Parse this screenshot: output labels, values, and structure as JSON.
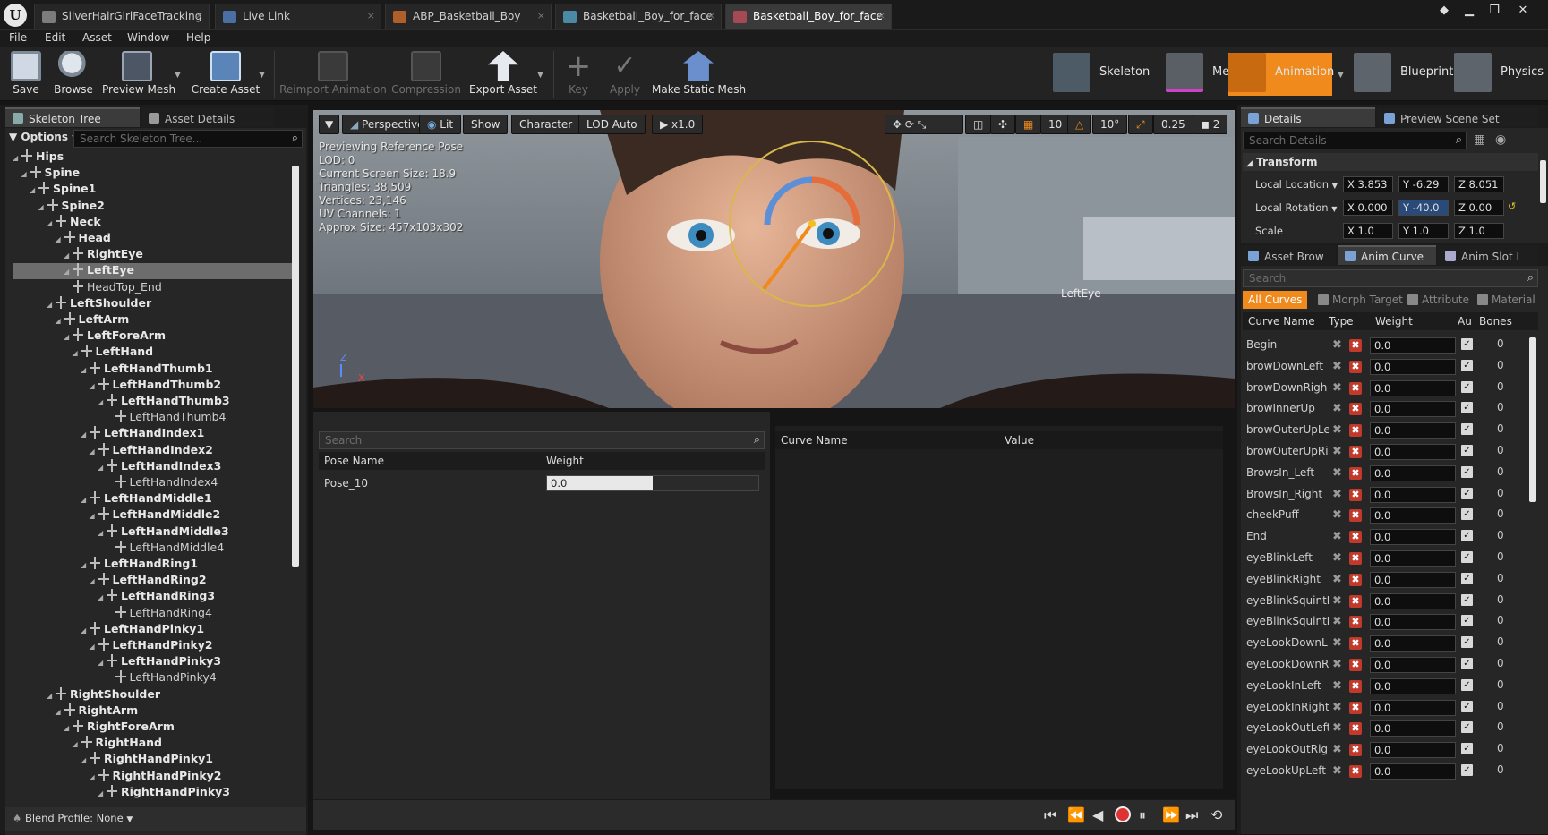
{
  "tabs": [
    {
      "label": "SilverHairGirlFaceTracking",
      "color": "#7c7c7c"
    },
    {
      "label": "Live Link",
      "color": "#4a6fa5"
    },
    {
      "label": "ABP_Basketball_Boy",
      "color": "#b05f2a"
    },
    {
      "label": "Basketball_Boy_for_face",
      "color": "#4a8aa5"
    },
    {
      "label": "Basketball_Boy_for_face",
      "color": "#a54a55"
    }
  ],
  "menu": [
    "File",
    "Edit",
    "Asset",
    "Window",
    "Help"
  ],
  "toolbar": {
    "save": "Save",
    "browse": "Browse",
    "preview_mesh": "Preview Mesh",
    "create_asset": "Create Asset",
    "reimport": "Reimport Animation",
    "compression": "Compression",
    "export_asset": "Export Asset",
    "key": "Key",
    "apply": "Apply",
    "make_static_mesh": "Make Static Mesh"
  },
  "modes": {
    "skeleton": "Skeleton",
    "mesh": "Mesh",
    "animation": "Animation",
    "blueprint": "Blueprint",
    "physics": "Physics"
  },
  "left_panel": {
    "tab_skeleton_tree": "Skeleton Tree",
    "tab_asset_details": "Asset Details",
    "options": "Options",
    "search_placeholder": "Search Skeleton Tree...",
    "bones": [
      {
        "name": "Hips",
        "depth": 0,
        "light": false
      },
      {
        "name": "Spine",
        "depth": 1,
        "light": false
      },
      {
        "name": "Spine1",
        "depth": 2,
        "light": false
      },
      {
        "name": "Spine2",
        "depth": 3,
        "light": false
      },
      {
        "name": "Neck",
        "depth": 4,
        "light": false
      },
      {
        "name": "Head",
        "depth": 5,
        "light": false
      },
      {
        "name": "RightEye",
        "depth": 6,
        "light": false
      },
      {
        "name": "LeftEye",
        "depth": 6,
        "light": false,
        "selected": true
      },
      {
        "name": "HeadTop_End",
        "depth": 6,
        "light": true
      },
      {
        "name": "LeftShoulder",
        "depth": 4,
        "light": false
      },
      {
        "name": "LeftArm",
        "depth": 5,
        "light": false
      },
      {
        "name": "LeftForeArm",
        "depth": 6,
        "light": false
      },
      {
        "name": "LeftHand",
        "depth": 7,
        "light": false
      },
      {
        "name": "LeftHandThumb1",
        "depth": 8,
        "light": false
      },
      {
        "name": "LeftHandThumb2",
        "depth": 9,
        "light": false
      },
      {
        "name": "LeftHandThumb3",
        "depth": 10,
        "light": false
      },
      {
        "name": "LeftHandThumb4",
        "depth": 11,
        "light": true
      },
      {
        "name": "LeftHandIndex1",
        "depth": 8,
        "light": false
      },
      {
        "name": "LeftHandIndex2",
        "depth": 9,
        "light": false
      },
      {
        "name": "LeftHandIndex3",
        "depth": 10,
        "light": false
      },
      {
        "name": "LeftHandIndex4",
        "depth": 11,
        "light": true
      },
      {
        "name": "LeftHandMiddle1",
        "depth": 8,
        "light": false
      },
      {
        "name": "LeftHandMiddle2",
        "depth": 9,
        "light": false
      },
      {
        "name": "LeftHandMiddle3",
        "depth": 10,
        "light": false
      },
      {
        "name": "LeftHandMiddle4",
        "depth": 11,
        "light": true
      },
      {
        "name": "LeftHandRing1",
        "depth": 8,
        "light": false
      },
      {
        "name": "LeftHandRing2",
        "depth": 9,
        "light": false
      },
      {
        "name": "LeftHandRing3",
        "depth": 10,
        "light": false
      },
      {
        "name": "LeftHandRing4",
        "depth": 11,
        "light": true
      },
      {
        "name": "LeftHandPinky1",
        "depth": 8,
        "light": false
      },
      {
        "name": "LeftHandPinky2",
        "depth": 9,
        "light": false
      },
      {
        "name": "LeftHandPinky3",
        "depth": 10,
        "light": false
      },
      {
        "name": "LeftHandPinky4",
        "depth": 11,
        "light": true
      },
      {
        "name": "RightShoulder",
        "depth": 4,
        "light": false
      },
      {
        "name": "RightArm",
        "depth": 5,
        "light": false
      },
      {
        "name": "RightForeArm",
        "depth": 6,
        "light": false
      },
      {
        "name": "RightHand",
        "depth": 7,
        "light": false
      },
      {
        "name": "RightHandPinky1",
        "depth": 8,
        "light": false
      },
      {
        "name": "RightHandPinky2",
        "depth": 9,
        "light": false
      },
      {
        "name": "RightHandPinky3",
        "depth": 10,
        "light": false
      }
    ],
    "blend_profile": "Blend Profile: None"
  },
  "viewport": {
    "perspective": "Perspective",
    "lit": "Lit",
    "show": "Show",
    "character": "Character",
    "lod": "LOD Auto",
    "play_rate": "x1.0",
    "grid_snap": "10",
    "rot_snap": "10°",
    "scale_snap": "0.25",
    "camera_speed": "2",
    "info": [
      "Previewing Reference Pose",
      "LOD: 0",
      "Current Screen Size: 18.9",
      "Triangles: 38,509",
      "Vertices: 23,146",
      "UV Channels: 1",
      "Approx Size: 457x103x302"
    ],
    "bone_label": "LeftEye",
    "axis_z": "Z",
    "axis_x": "X"
  },
  "pose_panel": {
    "search_placeholder": "Search",
    "col_pose_name": "Pose Name",
    "col_weight": "Weight",
    "rows": [
      {
        "name": "Pose_10",
        "weight": "0.0"
      }
    ]
  },
  "curve_value_panel": {
    "col_curve_name": "Curve Name",
    "col_value": "Value"
  },
  "details": {
    "tab_details": "Details",
    "tab_preview_scene": "Preview Scene Set",
    "search_placeholder": "Search Details",
    "transform": "Transform",
    "local_location": {
      "label": "Local Location",
      "x": "X 3.853",
      "y": "Y -6.29",
      "z": "Z 8.051"
    },
    "local_rotation": {
      "label": "Local Rotation",
      "x": "X 0.000",
      "y": "Y -40.0",
      "z": "Z 0.00"
    },
    "scale": {
      "label": "Scale",
      "x": "X 1.0",
      "y": "Y 1.0",
      "z": "Z 1.0"
    }
  },
  "curves_panel": {
    "tab_asset_browser": "Asset Brow",
    "tab_anim_curves": "Anim Curve",
    "tab_anim_slot": "Anim Slot I",
    "search_placeholder": "Search",
    "filter_all": "All Curves",
    "filter_morph": "Morph Target",
    "filter_attribute": "Attribute",
    "filter_material": "Material",
    "col_name": "Curve Name",
    "col_type": "Type",
    "col_weight": "Weight",
    "col_auto": "Au",
    "col_bones": "Bones",
    "curves": [
      {
        "name": "Begin",
        "weight": "0.0",
        "bones": "0"
      },
      {
        "name": "browDownLeft",
        "weight": "0.0",
        "bones": "0"
      },
      {
        "name": "browDownRigh",
        "weight": "0.0",
        "bones": "0"
      },
      {
        "name": "browInnerUp",
        "weight": "0.0",
        "bones": "0"
      },
      {
        "name": "browOuterUpLe",
        "weight": "0.0",
        "bones": "0"
      },
      {
        "name": "browOuterUpRig",
        "weight": "0.0",
        "bones": "0"
      },
      {
        "name": "BrowsIn_Left",
        "weight": "0.0",
        "bones": "0"
      },
      {
        "name": "BrowsIn_Right",
        "weight": "0.0",
        "bones": "0"
      },
      {
        "name": "cheekPuff",
        "weight": "0.0",
        "bones": "0"
      },
      {
        "name": "End",
        "weight": "0.0",
        "bones": "0"
      },
      {
        "name": "eyeBlinkLeft",
        "weight": "0.0",
        "bones": "0"
      },
      {
        "name": "eyeBlinkRight",
        "weight": "0.0",
        "bones": "0"
      },
      {
        "name": "eyeBlinkSquintL",
        "weight": "0.0",
        "bones": "0"
      },
      {
        "name": "eyeBlinkSquintF",
        "weight": "0.0",
        "bones": "0"
      },
      {
        "name": "eyeLookDownL",
        "weight": "0.0",
        "bones": "0"
      },
      {
        "name": "eyeLookDownRi",
        "weight": "0.0",
        "bones": "0"
      },
      {
        "name": "eyeLookInLeft",
        "weight": "0.0",
        "bones": "0"
      },
      {
        "name": "eyeLookInRight",
        "weight": "0.0",
        "bones": "0"
      },
      {
        "name": "eyeLookOutLeft",
        "weight": "0.0",
        "bones": "0"
      },
      {
        "name": "eyeLookOutRigh",
        "weight": "0.0",
        "bones": "0"
      },
      {
        "name": "eyeLookUpLeft",
        "weight": "0.0",
        "bones": "0"
      }
    ]
  }
}
